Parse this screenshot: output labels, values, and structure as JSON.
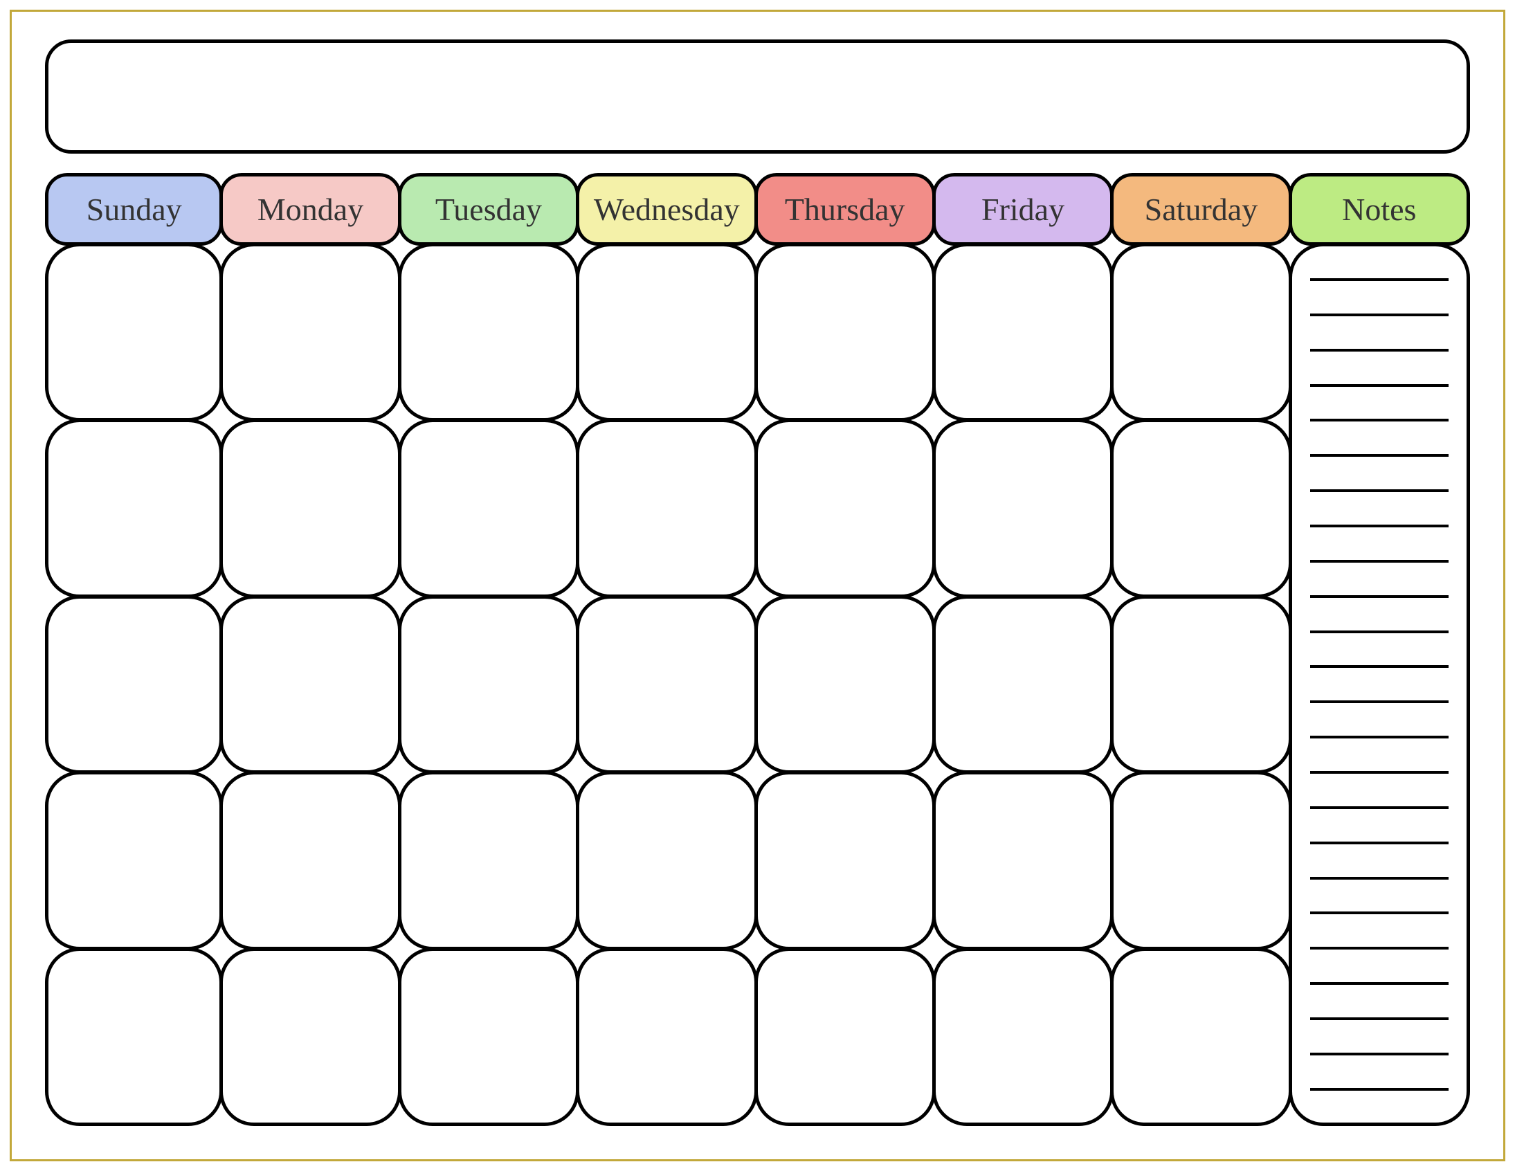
{
  "headers": {
    "sunday": {
      "label": "Sunday",
      "color": "#b8c8f2"
    },
    "monday": {
      "label": "Monday",
      "color": "#f6c9c6"
    },
    "tuesday": {
      "label": "Tuesday",
      "color": "#b9eab0"
    },
    "wednesday": {
      "label": "Wednesday",
      "color": "#f4f1a9"
    },
    "thursday": {
      "label": "Thursday",
      "color": "#f28d88"
    },
    "friday": {
      "label": "Friday",
      "color": "#d4b9ee"
    },
    "saturday": {
      "label": "Saturday",
      "color": "#f4b97e"
    },
    "notes": {
      "label": "Notes",
      "color": "#bdeb83"
    }
  },
  "grid": {
    "rows": 5,
    "day_columns": 7
  },
  "notes_lines": 24
}
